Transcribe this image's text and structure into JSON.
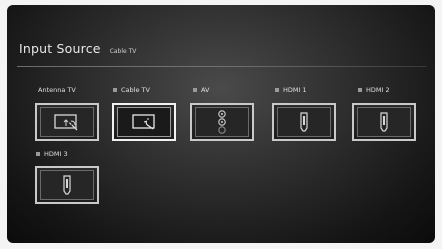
{
  "header": {
    "title": "Input Source",
    "current_source": "Cable TV"
  },
  "sources": [
    {
      "label": "Antenna TV",
      "icon": "antenna-tv-icon"
    },
    {
      "label": "Cable TV",
      "icon": "cable-tv-icon",
      "selected": true
    },
    {
      "label": "AV",
      "icon": "av-jacks-icon"
    },
    {
      "label": "HDMI 1",
      "icon": "hdmi-port-icon"
    },
    {
      "label": "HDMI 2",
      "icon": "hdmi-port-icon"
    },
    {
      "label": "HDMI 3",
      "icon": "hdmi-port-icon"
    }
  ]
}
